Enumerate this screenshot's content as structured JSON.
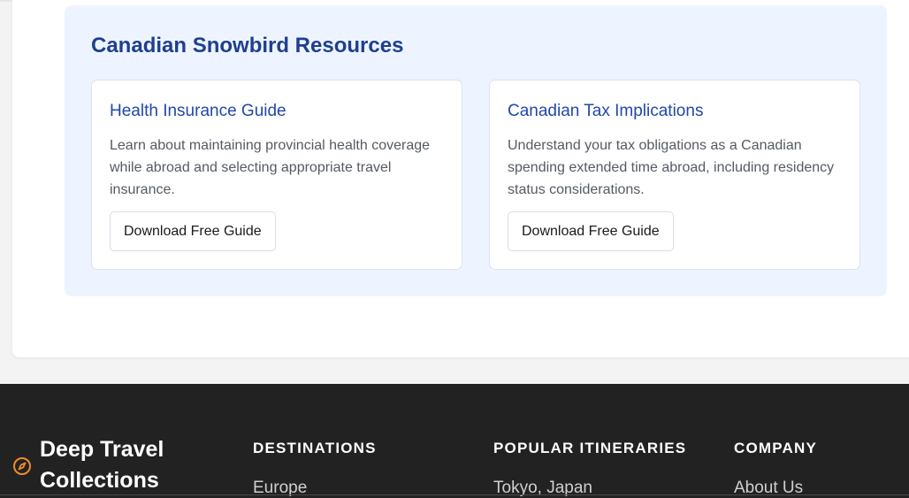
{
  "resources": {
    "title": "Canadian Snowbird Resources",
    "cards": [
      {
        "title": "Health Insurance Guide",
        "description": "Learn about maintaining provincial health coverage while abroad and selecting appropriate travel insurance.",
        "button": "Download Free Guide"
      },
      {
        "title": "Canadian Tax Implications",
        "description": "Understand your tax obligations as a Canadian spending extended time abroad, including residency status considerations.",
        "button": "Download Free Guide"
      }
    ]
  },
  "footer": {
    "brand": {
      "name": "Deep Travel Collections",
      "icon": "compass-icon",
      "icon_color": "#f28c28"
    },
    "columns": [
      {
        "heading": "DESTINATIONS",
        "first_link": "Europe"
      },
      {
        "heading": "POPULAR ITINERARIES",
        "first_link": "Tokyo, Japan"
      },
      {
        "heading": "COMPANY",
        "first_link": "About Us"
      }
    ]
  },
  "colors": {
    "accent_blue": "#1f3f8f",
    "link_blue": "#2148a8",
    "panel_bg": "#eef4ff",
    "footer_bg": "#222222"
  }
}
